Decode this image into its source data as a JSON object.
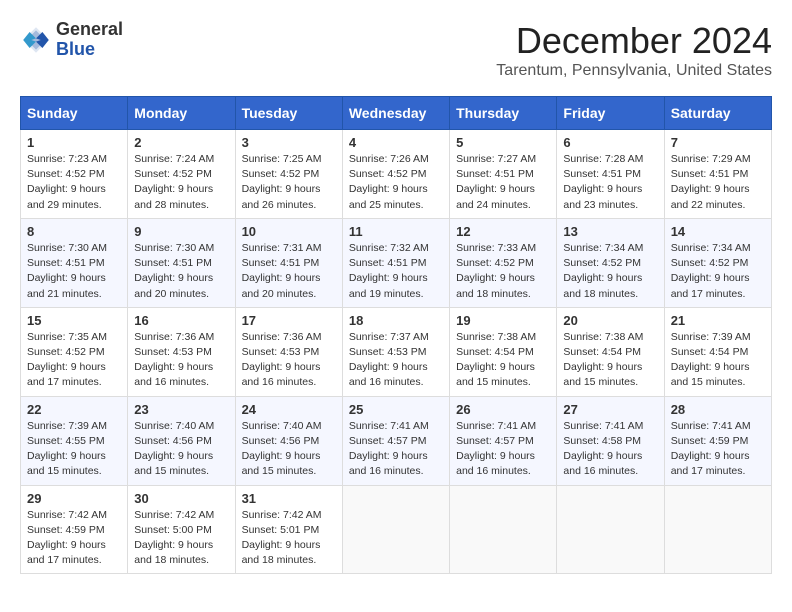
{
  "header": {
    "logo_general": "General",
    "logo_blue": "Blue",
    "month_title": "December 2024",
    "location": "Tarentum, Pennsylvania, United States"
  },
  "weekdays": [
    "Sunday",
    "Monday",
    "Tuesday",
    "Wednesday",
    "Thursday",
    "Friday",
    "Saturday"
  ],
  "weeks": [
    [
      {
        "day": "1",
        "sunrise": "7:23 AM",
        "sunset": "4:52 PM",
        "daylight": "9 hours and 29 minutes."
      },
      {
        "day": "2",
        "sunrise": "7:24 AM",
        "sunset": "4:52 PM",
        "daylight": "9 hours and 28 minutes."
      },
      {
        "day": "3",
        "sunrise": "7:25 AM",
        "sunset": "4:52 PM",
        "daylight": "9 hours and 26 minutes."
      },
      {
        "day": "4",
        "sunrise": "7:26 AM",
        "sunset": "4:52 PM",
        "daylight": "9 hours and 25 minutes."
      },
      {
        "day": "5",
        "sunrise": "7:27 AM",
        "sunset": "4:51 PM",
        "daylight": "9 hours and 24 minutes."
      },
      {
        "day": "6",
        "sunrise": "7:28 AM",
        "sunset": "4:51 PM",
        "daylight": "9 hours and 23 minutes."
      },
      {
        "day": "7",
        "sunrise": "7:29 AM",
        "sunset": "4:51 PM",
        "daylight": "9 hours and 22 minutes."
      }
    ],
    [
      {
        "day": "8",
        "sunrise": "7:30 AM",
        "sunset": "4:51 PM",
        "daylight": "9 hours and 21 minutes."
      },
      {
        "day": "9",
        "sunrise": "7:30 AM",
        "sunset": "4:51 PM",
        "daylight": "9 hours and 20 minutes."
      },
      {
        "day": "10",
        "sunrise": "7:31 AM",
        "sunset": "4:51 PM",
        "daylight": "9 hours and 20 minutes."
      },
      {
        "day": "11",
        "sunrise": "7:32 AM",
        "sunset": "4:51 PM",
        "daylight": "9 hours and 19 minutes."
      },
      {
        "day": "12",
        "sunrise": "7:33 AM",
        "sunset": "4:52 PM",
        "daylight": "9 hours and 18 minutes."
      },
      {
        "day": "13",
        "sunrise": "7:34 AM",
        "sunset": "4:52 PM",
        "daylight": "9 hours and 18 minutes."
      },
      {
        "day": "14",
        "sunrise": "7:34 AM",
        "sunset": "4:52 PM",
        "daylight": "9 hours and 17 minutes."
      }
    ],
    [
      {
        "day": "15",
        "sunrise": "7:35 AM",
        "sunset": "4:52 PM",
        "daylight": "9 hours and 17 minutes."
      },
      {
        "day": "16",
        "sunrise": "7:36 AM",
        "sunset": "4:53 PM",
        "daylight": "9 hours and 16 minutes."
      },
      {
        "day": "17",
        "sunrise": "7:36 AM",
        "sunset": "4:53 PM",
        "daylight": "9 hours and 16 minutes."
      },
      {
        "day": "18",
        "sunrise": "7:37 AM",
        "sunset": "4:53 PM",
        "daylight": "9 hours and 16 minutes."
      },
      {
        "day": "19",
        "sunrise": "7:38 AM",
        "sunset": "4:54 PM",
        "daylight": "9 hours and 15 minutes."
      },
      {
        "day": "20",
        "sunrise": "7:38 AM",
        "sunset": "4:54 PM",
        "daylight": "9 hours and 15 minutes."
      },
      {
        "day": "21",
        "sunrise": "7:39 AM",
        "sunset": "4:54 PM",
        "daylight": "9 hours and 15 minutes."
      }
    ],
    [
      {
        "day": "22",
        "sunrise": "7:39 AM",
        "sunset": "4:55 PM",
        "daylight": "9 hours and 15 minutes."
      },
      {
        "day": "23",
        "sunrise": "7:40 AM",
        "sunset": "4:56 PM",
        "daylight": "9 hours and 15 minutes."
      },
      {
        "day": "24",
        "sunrise": "7:40 AM",
        "sunset": "4:56 PM",
        "daylight": "9 hours and 15 minutes."
      },
      {
        "day": "25",
        "sunrise": "7:41 AM",
        "sunset": "4:57 PM",
        "daylight": "9 hours and 16 minutes."
      },
      {
        "day": "26",
        "sunrise": "7:41 AM",
        "sunset": "4:57 PM",
        "daylight": "9 hours and 16 minutes."
      },
      {
        "day": "27",
        "sunrise": "7:41 AM",
        "sunset": "4:58 PM",
        "daylight": "9 hours and 16 minutes."
      },
      {
        "day": "28",
        "sunrise": "7:41 AM",
        "sunset": "4:59 PM",
        "daylight": "9 hours and 17 minutes."
      }
    ],
    [
      {
        "day": "29",
        "sunrise": "7:42 AM",
        "sunset": "4:59 PM",
        "daylight": "9 hours and 17 minutes."
      },
      {
        "day": "30",
        "sunrise": "7:42 AM",
        "sunset": "5:00 PM",
        "daylight": "9 hours and 18 minutes."
      },
      {
        "day": "31",
        "sunrise": "7:42 AM",
        "sunset": "5:01 PM",
        "daylight": "9 hours and 18 minutes."
      },
      null,
      null,
      null,
      null
    ]
  ]
}
